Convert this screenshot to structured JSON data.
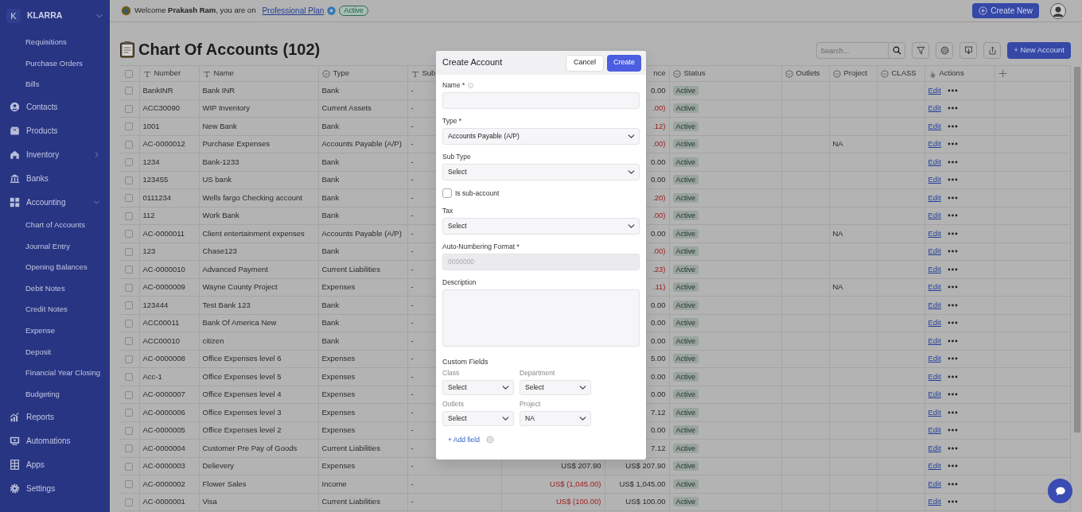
{
  "sidebar": {
    "workspace": {
      "initial": "K",
      "name": "KLARRA",
      "expanded": true,
      "children": [
        {
          "label": "Requisitions"
        },
        {
          "label": "Purchase Orders"
        },
        {
          "label": "Bills"
        }
      ]
    },
    "items": [
      {
        "label": "Contacts"
      },
      {
        "label": "Products"
      },
      {
        "label": "Inventory",
        "expanded": false
      },
      {
        "label": "Banks"
      },
      {
        "label": "Accounting",
        "expanded": true,
        "children": [
          {
            "label": "Chart of Accounts"
          },
          {
            "label": "Journal Entry"
          },
          {
            "label": "Opening Balances"
          },
          {
            "label": "Debit Notes"
          },
          {
            "label": "Credit Notes"
          },
          {
            "label": "Expense"
          },
          {
            "label": "Deposit"
          },
          {
            "label": "Financial Year Closing"
          },
          {
            "label": "Budgeting"
          }
        ]
      },
      {
        "label": "Reports"
      },
      {
        "label": "Automations"
      },
      {
        "label": "Apps"
      },
      {
        "label": "Settings"
      }
    ]
  },
  "top_bar": {
    "welcome": "Welcome **Prakash Ram**, you are on",
    "plan_link": "Professional Plan",
    "plan_status": "Active",
    "create_button": "Create New"
  },
  "page": {
    "title": "Chart Of Accounts (102)",
    "search_placeholder": "Search...",
    "new_button": "+ New Account"
  },
  "table": {
    "header_checked": false,
    "columns": [
      {
        "kind": "text",
        "label": "Number"
      },
      {
        "kind": "text",
        "label": "Name"
      },
      {
        "kind": "select",
        "label": "Type"
      },
      {
        "kind": "text",
        "label": "Sub"
      },
      {
        "kind": "amount"
      },
      {
        "kind": "amount",
        "label": "nce"
      },
      {
        "kind": "select",
        "label": "Status"
      },
      {
        "kind": "select",
        "label": "Outlets"
      },
      {
        "kind": "select",
        "label": "Project"
      },
      {
        "kind": "select",
        "label": "CLASS"
      },
      {
        "kind": "action",
        "label": "Actions"
      }
    ],
    "rows": [
      {
        "checked": false,
        "number": "BankINR",
        "name": "Bank INR",
        "type": "Bank",
        "sub_type": "-",
        "balance": {
          "text": "0.00",
          "negative": false
        },
        "status": "Active",
        "action": "Edit"
      },
      {
        "checked": false,
        "number": "ACC30090",
        "name": "WIP Inventory",
        "type": "Current Assets",
        "sub_type": "-",
        "balance": {
          "text": ".00)",
          "negative": true
        },
        "status": "Active",
        "action": "Edit"
      },
      {
        "checked": false,
        "number": "1001",
        "name": "New Bank",
        "type": "Bank",
        "sub_type": "-",
        "balance": {
          "text": ".12)",
          "negative": true
        },
        "status": "Active",
        "action": "Edit"
      },
      {
        "checked": false,
        "number": "AC-0000012",
        "name": "Purchase Expenses",
        "type": "Accounts Payable (A/P)",
        "sub_type": "-",
        "balance": {
          "text": ".00)",
          "negative": true
        },
        "status": "Active",
        "project": "NA",
        "action": "Edit"
      },
      {
        "checked": false,
        "number": "1234",
        "name": "Bank-1233",
        "type": "Bank",
        "sub_type": "-",
        "balance": {
          "text": "0.00",
          "negative": false
        },
        "status": "Active",
        "action": "Edit"
      },
      {
        "checked": false,
        "number": "123455",
        "name": "US bank",
        "type": "Bank",
        "sub_type": "-",
        "balance": {
          "text": "0.00",
          "negative": false
        },
        "status": "Active",
        "action": "Edit"
      },
      {
        "checked": false,
        "number": "0111234",
        "name": "Wells fargo Checking account",
        "type": "Bank",
        "sub_type": "-",
        "balance": {
          "text": ".20)",
          "negative": true
        },
        "status": "Active",
        "action": "Edit"
      },
      {
        "checked": false,
        "number": "112",
        "name": "Work Bank",
        "type": "Bank",
        "sub_type": "-",
        "balance": {
          "text": ".00)",
          "negative": true
        },
        "status": "Active",
        "action": "Edit"
      },
      {
        "checked": false,
        "number": "AC-0000011",
        "name": "Client entertainment expenses",
        "type": "Accounts Payable (A/P)",
        "sub_type": "-",
        "balance": {
          "text": "0.00",
          "negative": false
        },
        "status": "Active",
        "project": "NA",
        "action": "Edit"
      },
      {
        "checked": false,
        "number": "123",
        "name": "Chase123",
        "type": "Bank",
        "sub_type": "-",
        "balance": {
          "text": ".00)",
          "negative": true
        },
        "status": "Active",
        "action": "Edit"
      },
      {
        "checked": false,
        "number": "AC-0000010",
        "name": "Advanced Payment",
        "type": "Current Liabilities",
        "sub_type": "-",
        "balance": {
          "text": ".23)",
          "negative": true
        },
        "status": "Active",
        "action": "Edit"
      },
      {
        "checked": false,
        "number": "AC-0000009",
        "name": "Wayne County Project",
        "type": "Expenses",
        "sub_type": "-",
        "balance": {
          "text": ".11)",
          "negative": true
        },
        "status": "Active",
        "project": "NA",
        "action": "Edit"
      },
      {
        "checked": false,
        "number": "123444",
        "name": "Test Bank 123",
        "type": "Bank",
        "sub_type": "-",
        "balance": {
          "text": "0.00",
          "negative": false
        },
        "status": "Active",
        "action": "Edit"
      },
      {
        "checked": false,
        "number": "ACC00011",
        "name": "Bank Of America New",
        "type": "Bank",
        "sub_type": "-",
        "balance": {
          "text": "0.00",
          "negative": false
        },
        "status": "Active",
        "action": "Edit"
      },
      {
        "checked": false,
        "number": "ACC00010",
        "name": "citizen",
        "type": "Bank",
        "sub_type": "-",
        "balance": {
          "text": "0.00",
          "negative": false
        },
        "status": "Active",
        "action": "Edit"
      },
      {
        "checked": false,
        "number": "AC-0000008",
        "name": "Office Expenses level 6",
        "type": "Expenses",
        "sub_type": "-",
        "balance": {
          "text": "5.00",
          "negative": false
        },
        "status": "Active",
        "action": "Edit"
      },
      {
        "checked": false,
        "number": "Acc-1",
        "name": "Office Expenses level 5",
        "type": "Expenses",
        "sub_type": "-",
        "balance": {
          "text": "0.00",
          "negative": false
        },
        "status": "Active",
        "action": "Edit"
      },
      {
        "checked": false,
        "number": "AC-0000007",
        "name": "Office Expenses level 4",
        "type": "Expenses",
        "sub_type": "-",
        "balance": {
          "text": "0.00",
          "negative": false
        },
        "status": "Active",
        "action": "Edit"
      },
      {
        "checked": false,
        "number": "AC-0000006",
        "name": "Office Expenses level 3",
        "type": "Expenses",
        "sub_type": "-",
        "balance": {
          "text": "7.12",
          "negative": false
        },
        "status": "Active",
        "action": "Edit"
      },
      {
        "checked": false,
        "number": "AC-0000005",
        "name": "Office Expenses level 2",
        "type": "Expenses",
        "sub_type": "-",
        "balance": {
          "text": "0.00",
          "negative": false
        },
        "status": "Active",
        "action": "Edit"
      },
      {
        "checked": false,
        "number": "AC-0000004",
        "name": "Customer Pre Pay of Goods",
        "type": "Current Liabilities",
        "sub_type": "-",
        "balance": {
          "text": "7.12",
          "negative": false
        },
        "status": "Active",
        "action": "Edit"
      },
      {
        "checked": false,
        "number": "AC-0000003",
        "name": "Delievery",
        "type": "Expenses",
        "sub_type": "-",
        "amount": {
          "text": "US$ 207.90",
          "negative": false
        },
        "balance": {
          "text": "US$ 207.90",
          "negative": false
        },
        "status": "Active",
        "action": "Edit"
      },
      {
        "checked": false,
        "number": "AC-0000002",
        "name": "Flower Sales",
        "type": "Income",
        "sub_type": "-",
        "amount": {
          "text": "US$ (1,045.00)",
          "negative": true
        },
        "balance": {
          "text": "US$ 1,045.00",
          "negative": false
        },
        "status": "Active",
        "action": "Edit"
      },
      {
        "checked": false,
        "number": "AC-0000001",
        "name": "Visa",
        "type": "Current Liabilities",
        "sub_type": "-",
        "amount": {
          "text": "US$ (100.00)",
          "negative": true
        },
        "balance": {
          "text": "US$ 100.00",
          "negative": false
        },
        "status": "Active",
        "action": "Edit"
      }
    ]
  },
  "modal": {
    "title": "Create Account",
    "buttons": [
      {
        "label": "Cancel",
        "kind": "secondary"
      },
      {
        "label": "Create",
        "kind": "primary"
      }
    ],
    "fields": [
      {
        "kind": "text",
        "label": "Name *",
        "info": true
      },
      {
        "kind": "select",
        "label": "Type *",
        "value": "Accounts Payable (A/P)"
      },
      {
        "kind": "select",
        "label": "Sub Type",
        "value": "Select"
      },
      {
        "kind": "checkbox",
        "label": "Is sub-account",
        "checked": false
      },
      {
        "kind": "select",
        "label": "Tax",
        "value": "Select"
      },
      {
        "kind": "text",
        "label": "Auto-Numbering Format *",
        "placeholder": "0000000",
        "disabled": true
      },
      {
        "kind": "textarea",
        "label": "Description"
      }
    ],
    "custom_fields": {
      "title": "Custom Fields",
      "fields": [
        {
          "label": "Class",
          "value": "Select"
        },
        {
          "label": "Department",
          "value": "Select"
        },
        {
          "label": "Outlets",
          "value": "Select"
        },
        {
          "label": "Project",
          "value": "NA"
        }
      ],
      "add_link": "+ Add field"
    }
  }
}
